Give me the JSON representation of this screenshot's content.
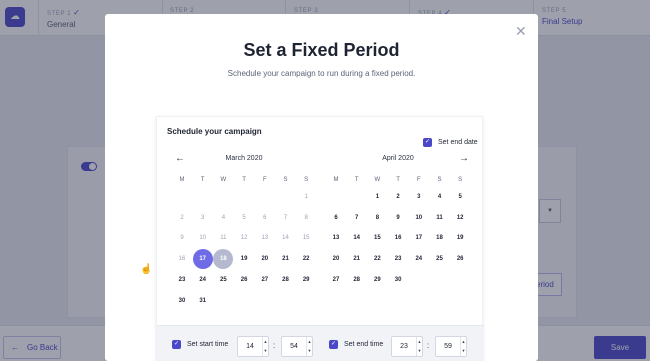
{
  "app": {
    "logo_icon": "cloud-icon",
    "steps": [
      {
        "num": "STEP 1",
        "label": "General",
        "checked": true
      },
      {
        "num": "STEP 2",
        "label": "",
        "checked": false
      },
      {
        "num": "STEP 3",
        "label": "",
        "checked": false
      },
      {
        "num": "STEP 4",
        "label": "",
        "checked": true
      },
      {
        "num": "STEP 5",
        "label": "Final Setup",
        "checked": false
      }
    ],
    "background_button_label": "eriod",
    "go_back_label": "Go Back",
    "save_label": "Save"
  },
  "modal": {
    "title": "Set a Fixed Period",
    "subtitle": "Schedule your campaign to run during a fixed period.",
    "calendar": {
      "heading": "Schedule your campaign",
      "set_end_date_label": "Set end date",
      "weekdays": [
        "M",
        "T",
        "W",
        "T",
        "F",
        "S",
        "S"
      ],
      "months": [
        {
          "name": "March 2020",
          "weeks": [
            [
              "",
              "",
              "",
              "",
              "",
              "",
              "1"
            ],
            [
              "2",
              "3",
              "4",
              "5",
              "6",
              "7",
              "8"
            ],
            [
              "9",
              "10",
              "11",
              "12",
              "13",
              "14",
              "15"
            ],
            [
              "16",
              "17",
              "18",
              "19",
              "20",
              "21",
              "22"
            ],
            [
              "23",
              "24",
              "25",
              "26",
              "27",
              "28",
              "29"
            ],
            [
              "30",
              "31",
              "",
              "",
              "",
              "",
              ""
            ]
          ]
        },
        {
          "name": "April 2020",
          "weeks": [
            [
              "",
              "",
              "1",
              "2",
              "3",
              "4",
              "5"
            ],
            [
              "6",
              "7",
              "8",
              "9",
              "10",
              "11",
              "12"
            ],
            [
              "13",
              "14",
              "15",
              "16",
              "17",
              "18",
              "19"
            ],
            [
              "20",
              "21",
              "22",
              "23",
              "24",
              "25",
              "26"
            ],
            [
              "27",
              "28",
              "29",
              "30",
              "",
              "",
              ""
            ]
          ]
        }
      ],
      "selected_day": "17",
      "hovered_day": "18",
      "today_day": "19",
      "start_time": {
        "label": "Set start time",
        "hour": "14",
        "minute": "54"
      },
      "end_time": {
        "label": "Set end time",
        "hour": "23",
        "minute": "59"
      }
    }
  },
  "colors": {
    "accent": "#4a47c9",
    "selected": "#6f6ae6",
    "hover": "#b5b9d0"
  }
}
